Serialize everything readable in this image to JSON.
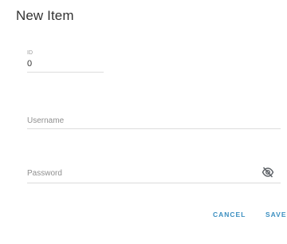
{
  "dialog": {
    "title": "New Item"
  },
  "fields": {
    "id": {
      "label": "ID",
      "value": "0"
    },
    "username": {
      "placeholder": "Username"
    },
    "password": {
      "placeholder": "Password",
      "toggle_icon": "eye-off-icon"
    }
  },
  "actions": {
    "cancel_label": "CANCEL",
    "save_label": "SAVE"
  },
  "colors": {
    "accent": "#3c8fc0",
    "underline": "#dcdcdc",
    "placeholder": "#8f8f8f"
  }
}
